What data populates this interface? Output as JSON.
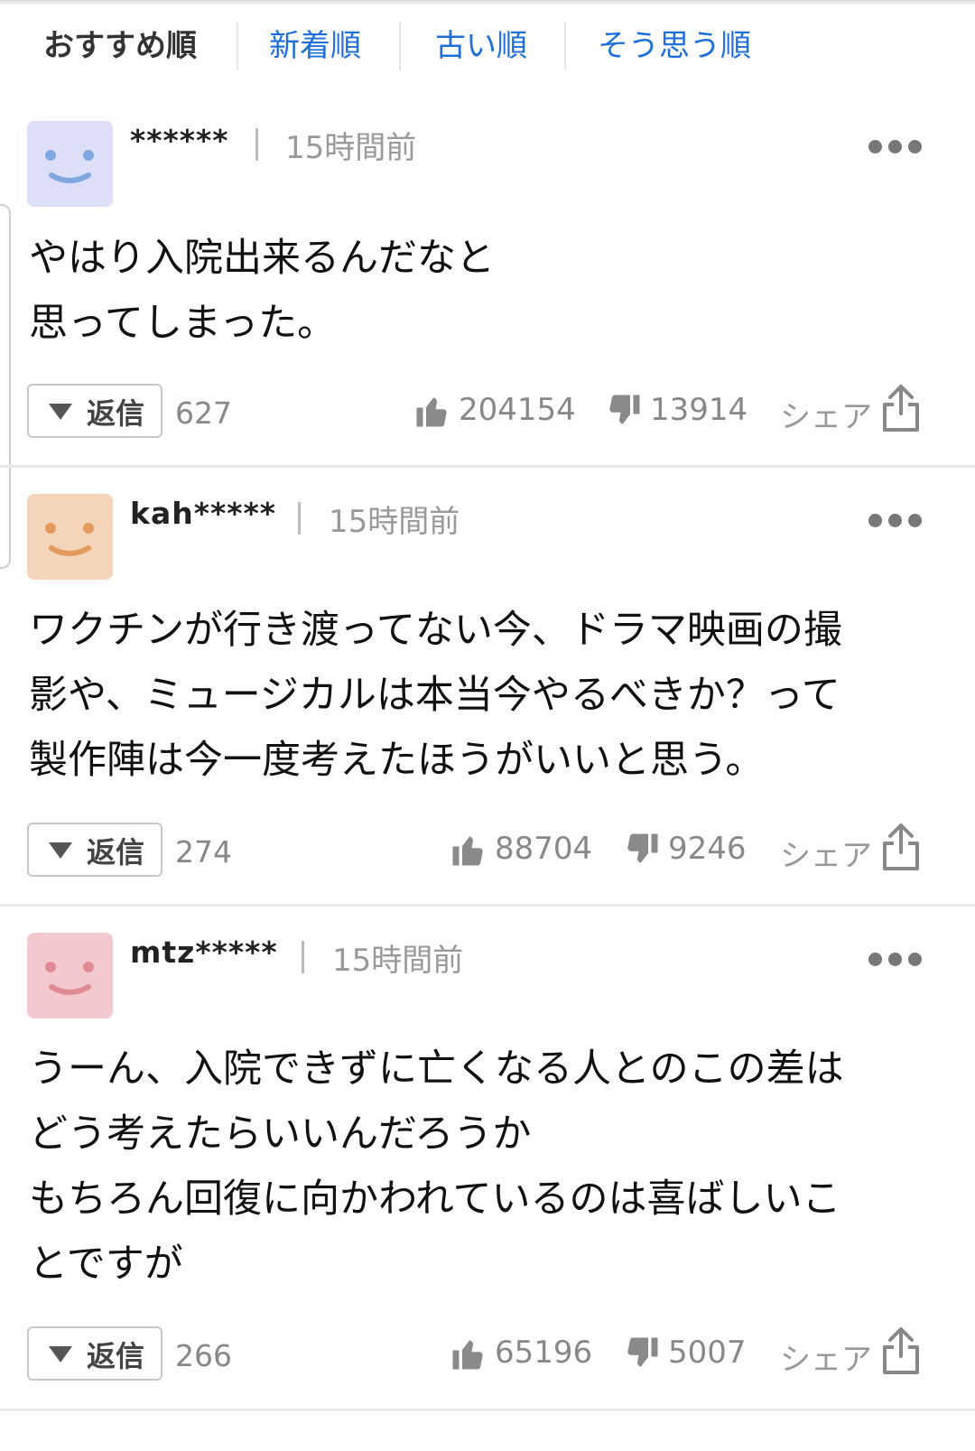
{
  "sort_tabs": [
    "おすすめ順",
    "新着順",
    "古い順",
    "そう思う順"
  ],
  "comments": [
    {
      "username": "******",
      "time": "15時間前",
      "avatar_color": "#dcdff7",
      "avatar_face_color": "#7fa7e0",
      "body": "やはり入院出来るんだなと\n思ってしまった。",
      "reply_label": "返信",
      "reply_count": "627",
      "likes": "204154",
      "dislikes": "13914",
      "share_label": "シェア"
    },
    {
      "username": "kah*****",
      "time": "15時間前",
      "avatar_color": "#f5d5b9",
      "avatar_face_color": "#e39a5e",
      "body": "ワクチンが行き渡ってない今、ドラマ映画の撮\n影や、ミュージカルは本当今やるべきか？って\n製作陣は今一度考えたほうがいいと思う。",
      "reply_label": "返信",
      "reply_count": "274",
      "likes": "88704",
      "dislikes": "9246",
      "share_label": "シェア"
    },
    {
      "username": "mtz*****",
      "time": "15時間前",
      "avatar_color": "#f3c9cf",
      "avatar_face_color": "#e08b93",
      "body": "うーん、入院できずに亡くなる人とのこの差は\nどう考えたらいいんだろうか\nもちろん回復に向かわれているのは喜ばしいこ\nとですが",
      "reply_label": "返信",
      "reply_count": "266",
      "likes": "65196",
      "dislikes": "5007",
      "share_label": "シェア"
    }
  ]
}
